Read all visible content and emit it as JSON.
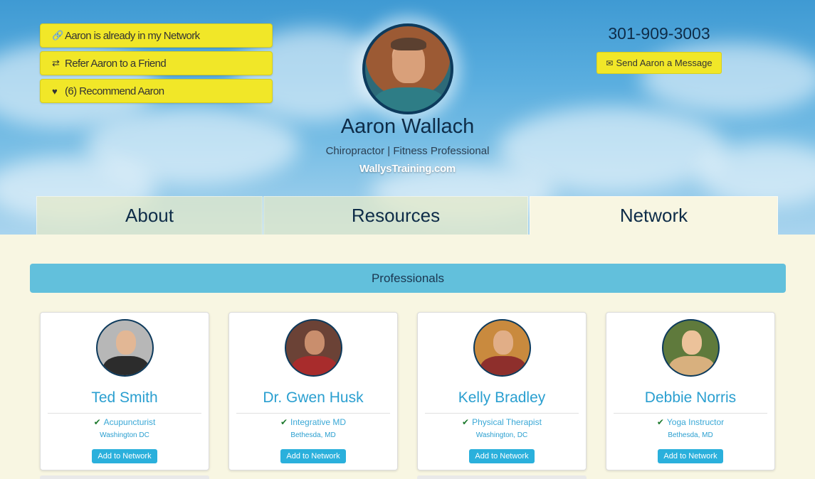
{
  "actions": {
    "network_label": "Aaron is already in my Network",
    "refer_label": "Refer Aaron to a Friend",
    "recommend_label": "(6) Recommend Aaron"
  },
  "profile": {
    "name": "Aaron Wallach",
    "title": "Chiropractor | Fitness Professional",
    "website": "WallysTraining.com"
  },
  "contact": {
    "phone": "301-909-3003",
    "message_label": "Send Aaron a Message"
  },
  "tabs": [
    {
      "label": "About",
      "active": false
    },
    {
      "label": "Resources",
      "active": false
    },
    {
      "label": "Network",
      "active": true
    }
  ],
  "section": {
    "title": "Professionals"
  },
  "professionals": [
    {
      "name": "Ted Smith",
      "role": "Acupuncturist",
      "location": "Washington DC",
      "button": "Add to Network"
    },
    {
      "name": "Dr. Gwen Husk",
      "role": "Integrative MD",
      "location": "Bethesda, MD",
      "button": "Add to Network"
    },
    {
      "name": "Kelly Bradley",
      "role": "Physical Therapist",
      "location": "Washington, DC",
      "button": "Add to Network"
    },
    {
      "name": "Debbie Norris",
      "role": "Yoga Instructor",
      "location": "Bethesda, MD",
      "button": "Add to Network"
    }
  ],
  "colors": {
    "accent_yellow": "#f1e728",
    "section_bar": "#62c0dc",
    "link_blue": "#2a9fd0",
    "page_bg": "#f8f6e2"
  }
}
